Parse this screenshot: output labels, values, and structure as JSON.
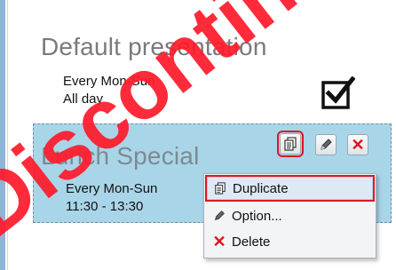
{
  "items": [
    {
      "title": "Default presentation",
      "days": "Every Mon-Sun",
      "time": "All day"
    },
    {
      "title": "Lunch Special",
      "days": "Every Mon-Sun",
      "time": "11:30 - 13:30"
    }
  ],
  "context_menu": {
    "duplicate": "Duplicate",
    "option": "Option...",
    "delete": "Delete"
  },
  "watermark": "Discontinued",
  "colors": {
    "selected_item_bg": "#a9d5e8",
    "highlight_red": "#e0171f",
    "watermark_red": "#ff1a2a"
  },
  "icons": {
    "active": "check-square-icon",
    "duplicate": "duplicate-icon",
    "edit": "pencil-icon",
    "delete": "close-icon"
  }
}
